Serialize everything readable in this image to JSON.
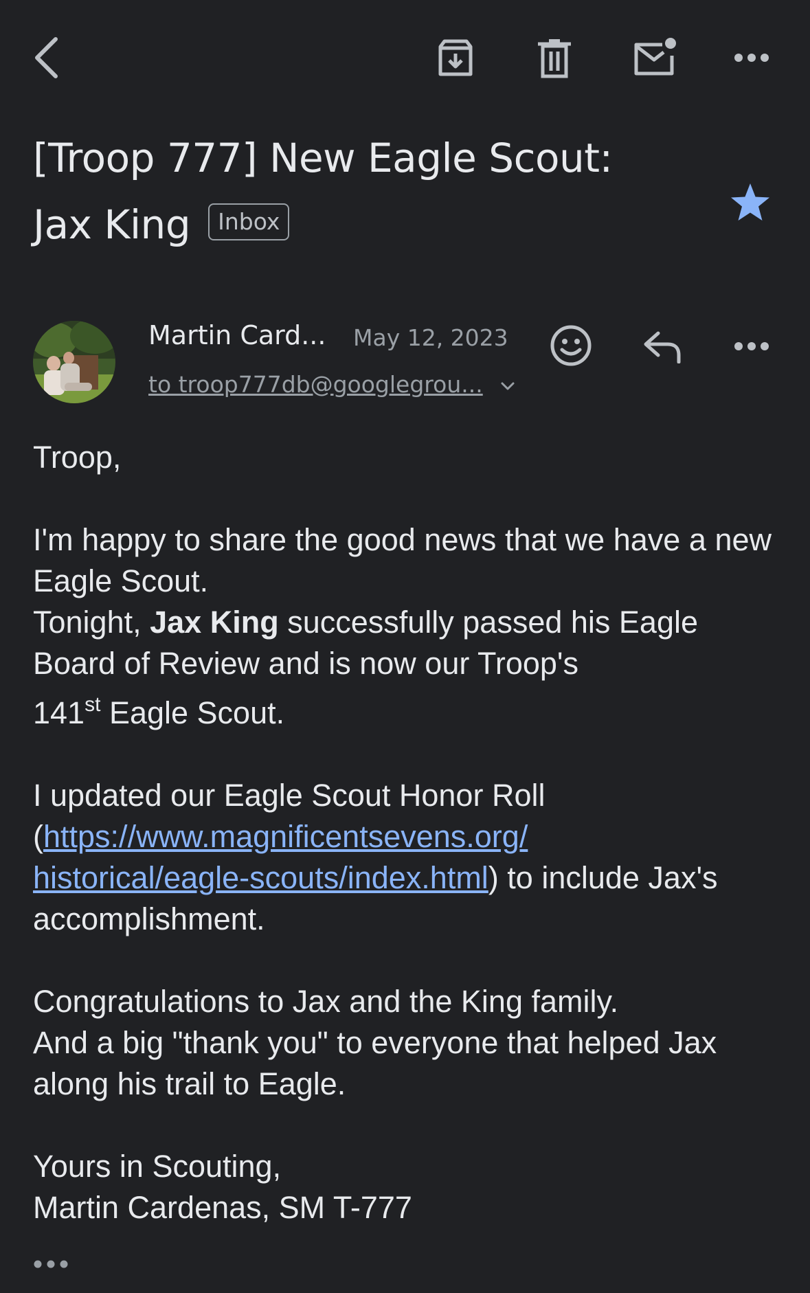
{
  "toolbar": {
    "back": "back",
    "archive": "archive",
    "delete": "delete",
    "mark_unread": "mark-unread",
    "more": "more"
  },
  "email": {
    "subject_line1": "[Troop 777] New Eagle Scout:",
    "subject_line2": "Jax King",
    "label": "Inbox",
    "starred": true,
    "star_color": "#8ab4f8"
  },
  "sender": {
    "name": "Martin Card...",
    "date": "May 12, 2023",
    "recipient": "to troop777db@googlegrou..."
  },
  "body": {
    "greeting": "Troop,",
    "p1": "I'm happy to share the good news that we have a new Eagle Scout.",
    "p2_pre": "Tonight, ",
    "p2_bold": "Jax King",
    "p2_post": " successfully passed his Eagle Board of Review and is now our Troop's",
    "p3_num": "141",
    "p3_sup": "st",
    "p3_post": " Eagle Scout.",
    "p4_pre": "I updated our Eagle Scout Honor Roll",
    "p4_open": "(",
    "p4_link1": "https://www.magnificentsevens.org/",
    "p4_link2": "historical/eagle-scouts/index.html",
    "p4_post": ") to include Jax's",
    "p4_end": "accomplishment.",
    "p5": "Congratulations to Jax and the King family.",
    "p6": "And a big \"thank you\" to everyone that helped Jax along his trail to Eagle.",
    "sign1": "Yours in Scouting,",
    "sign2": "Martin Cardenas, SM T-777"
  }
}
